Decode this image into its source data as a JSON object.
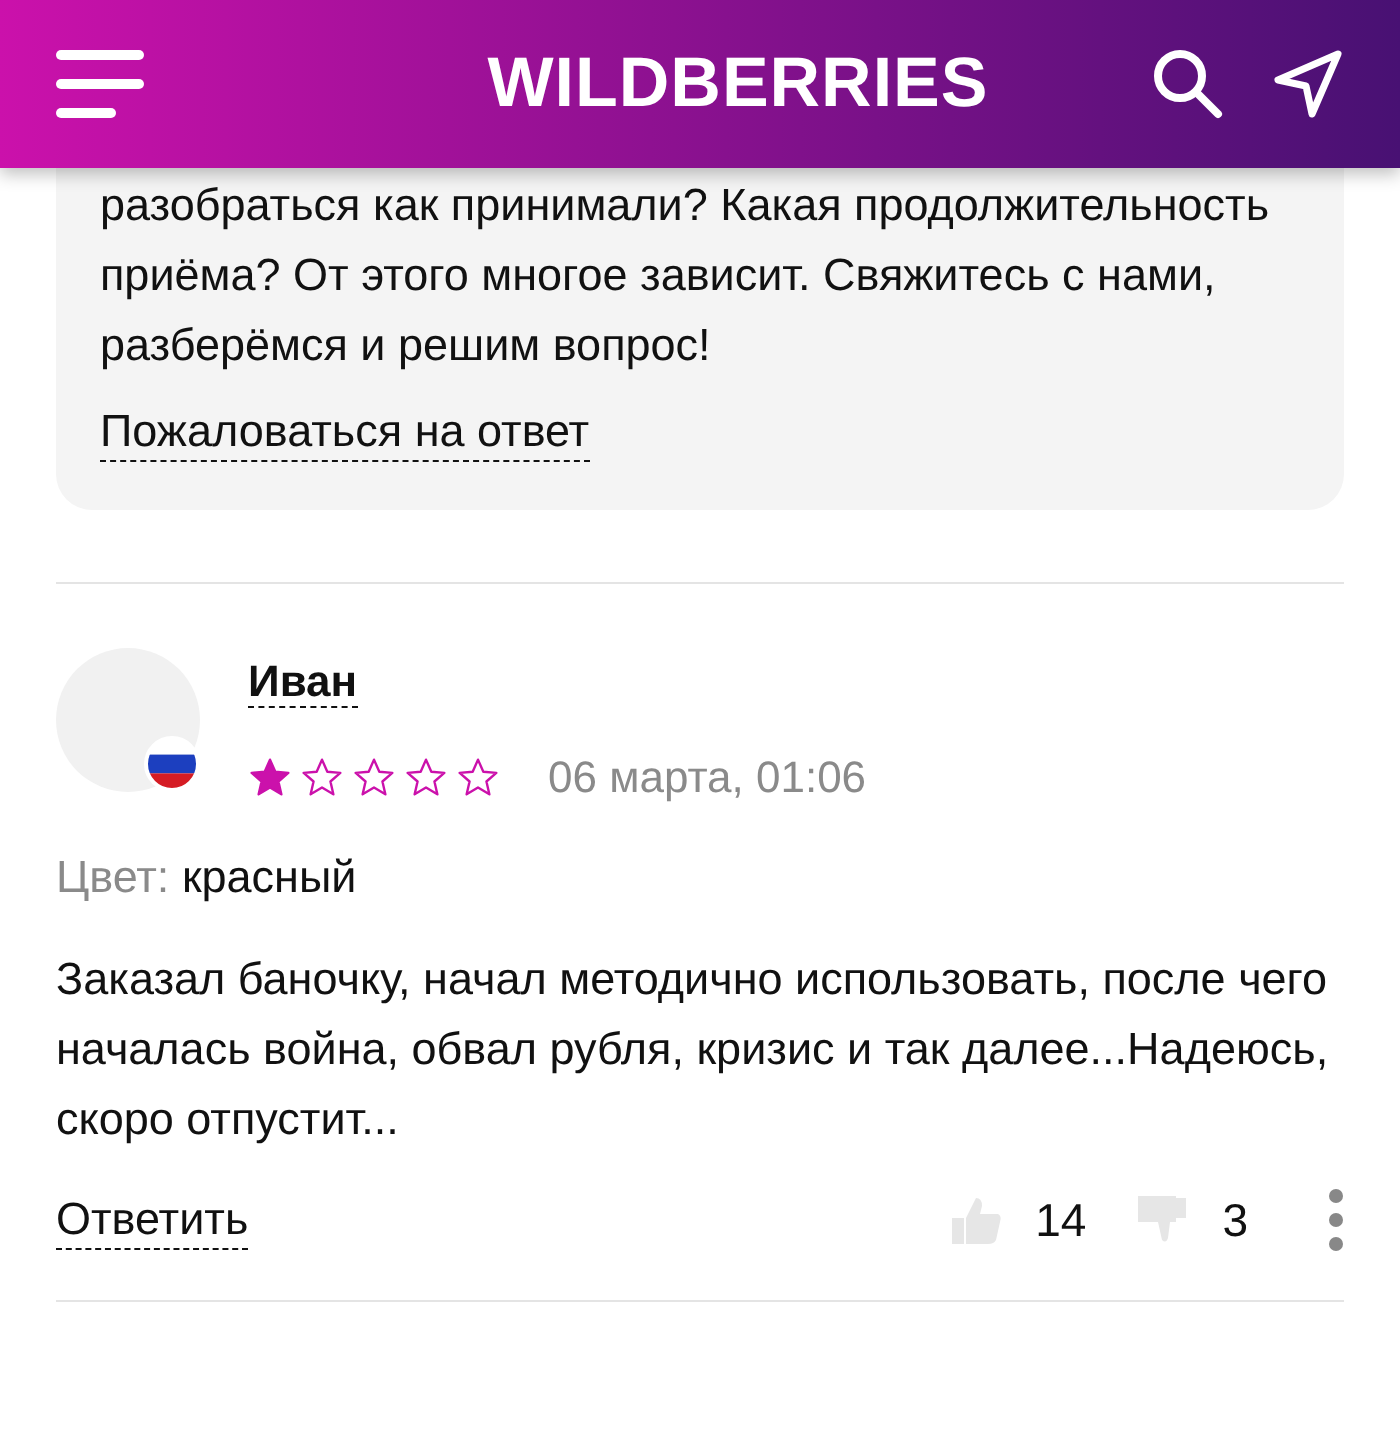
{
  "header": {
    "logo": "WILDBERRIES"
  },
  "answer": {
    "text": "разобраться как принимали? Какая продолжительность приёма? От этого многое зависит. Свяжитесь с нами, разберёмся и решим вопрос!",
    "complain_link": "Пожаловаться на ответ"
  },
  "review": {
    "author": "Иван",
    "stars": 1,
    "date": "06 марта, 01:06",
    "color_label": "Цвет:",
    "color_value": "красный",
    "text": "Заказал баночку, начал методично использовать, после чего началась война, обвал рубля, кризис и так далее...Надеюсь, скоро отпустит...",
    "reply_link": "Ответить",
    "likes": "14",
    "dislikes": "3"
  }
}
